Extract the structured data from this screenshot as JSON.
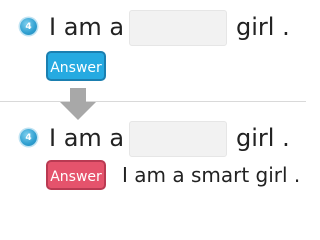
{
  "question": {
    "number": "4",
    "prefix": "I am a",
    "suffix": "girl ."
  },
  "before": {
    "button_label": "Answer",
    "button_color": "#26aae1"
  },
  "after": {
    "button_label": "Answer",
    "button_color": "#e5536c",
    "answer_text": "I am a smart girl ."
  },
  "arrow_icon": "down-arrow-icon"
}
